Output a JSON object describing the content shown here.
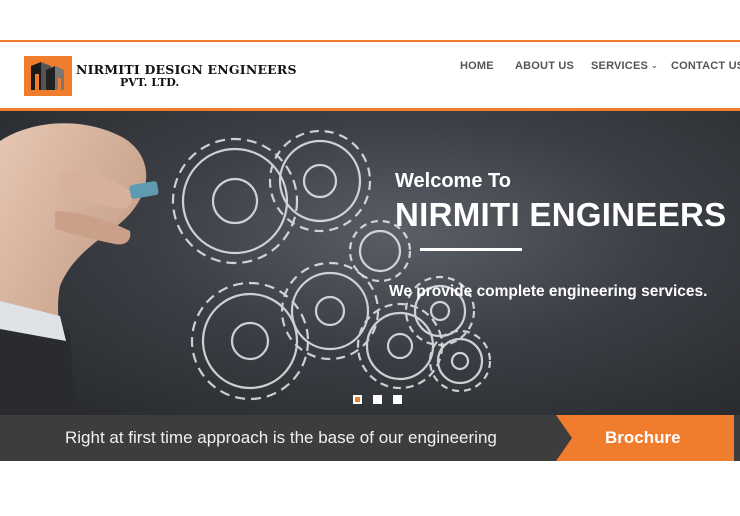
{
  "logo": {
    "line1": "NIRMITI DESIGN ENGINEERS",
    "line2": "PVT. LTD."
  },
  "nav": {
    "items": [
      "HOME",
      "ABOUT US",
      "SERVICES",
      "CONTACT US"
    ]
  },
  "hero": {
    "welcome": "Welcome To",
    "company": "NIRMITI ENGINEERS",
    "tagline": "We provide complete engineering services."
  },
  "slider": {
    "slide_count": 3,
    "active_slide": 1
  },
  "bar": {
    "text": "Right at first time approach is the base of our engineering",
    "brochure_label": "Brochure"
  },
  "colors": {
    "accent": "#f07c2e",
    "bar": "#3d3d3d",
    "nav_text": "#555555"
  },
  "icons": {
    "services_dropdown": "chevron-down-icon"
  }
}
